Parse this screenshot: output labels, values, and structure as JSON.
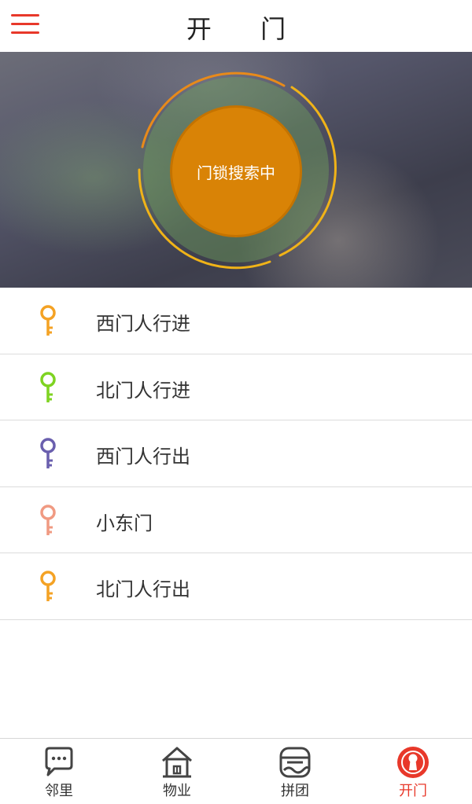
{
  "header": {
    "title": "开 门",
    "menu_icon": "hamburger-menu-icon",
    "accent_color": "#e8382a"
  },
  "hero": {
    "search_label": "门锁搜索中",
    "button_color": "#d98306",
    "ring_color": "#f0b318"
  },
  "doors": [
    {
      "label": "西门人行进",
      "icon": "key-icon",
      "color": "#f4a224"
    },
    {
      "label": "北门人行进",
      "icon": "key-icon",
      "color": "#7ed321"
    },
    {
      "label": "西门人行出",
      "icon": "key-icon",
      "color": "#6a5fae"
    },
    {
      "label": "小东门",
      "icon": "key-icon",
      "color": "#f09a82"
    },
    {
      "label": "北门人行出",
      "icon": "key-icon",
      "color": "#f4a224"
    }
  ],
  "tabs": [
    {
      "label": "邻里",
      "icon": "chat-bubble-icon",
      "active": false
    },
    {
      "label": "物业",
      "icon": "house-icon",
      "active": false
    },
    {
      "label": "拼团",
      "icon": "group-buy-icon",
      "active": false
    },
    {
      "label": "开门",
      "icon": "keyhole-icon",
      "active": true
    }
  ]
}
